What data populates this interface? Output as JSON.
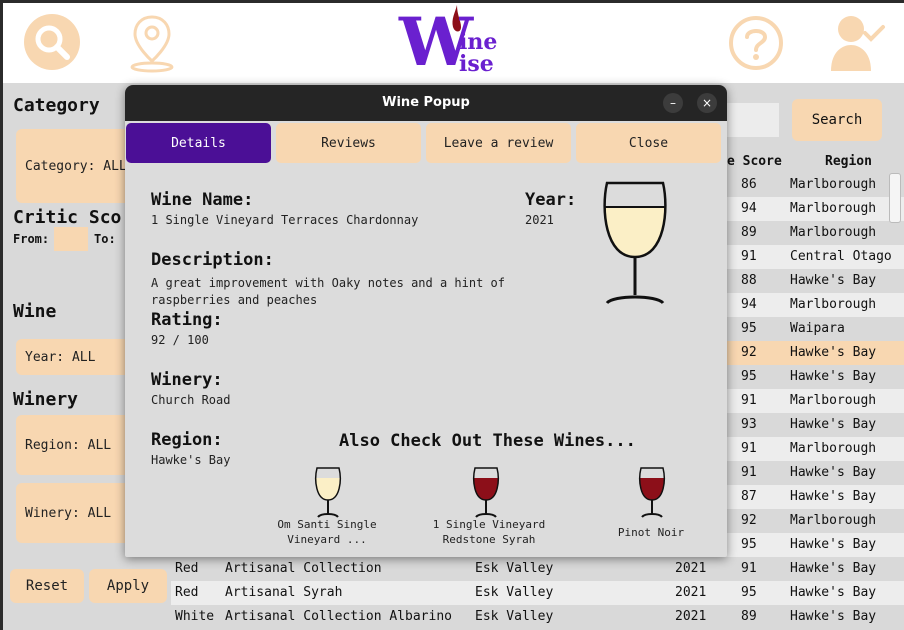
{
  "header": {
    "logo_text_big": "W",
    "logo_text_top": "ine",
    "logo_text_bottom": "ise",
    "icons": [
      "search-icon",
      "location-icon",
      "help-icon",
      "user-check-icon"
    ],
    "accent_color": "#f8d7b1"
  },
  "sidebar": {
    "category_heading": "Category",
    "category_value": "Category: ALL",
    "critic_heading": "Critic Sco",
    "from_label": "From:",
    "to_label": "To:",
    "wine_heading": "Wine",
    "year_value": "Year: ALL",
    "winery_heading": "Winery",
    "region_value": "Region: ALL",
    "winery_value": "Winery: ALL",
    "reset_label": "Reset",
    "apply_label": "Apply"
  },
  "search": {
    "button_label": "Search"
  },
  "table": {
    "col_score": "e Score",
    "col_region": "Region",
    "rows": [
      {
        "score": "86",
        "region": "Marlborough"
      },
      {
        "score": "94",
        "region": "Marlborough"
      },
      {
        "score": "89",
        "region": "Marlborough"
      },
      {
        "score": "91",
        "region": "Central Otago"
      },
      {
        "score": "88",
        "region": "Hawke's Bay"
      },
      {
        "score": "94",
        "region": "Marlborough"
      },
      {
        "score": "95",
        "region": "Waipara"
      },
      {
        "score": "92",
        "region": "Hawke's Bay"
      },
      {
        "score": "95",
        "region": "Hawke's Bay"
      },
      {
        "score": "91",
        "region": "Marlborough"
      },
      {
        "score": "93",
        "region": "Hawke's Bay"
      },
      {
        "score": "91",
        "region": "Marlborough"
      },
      {
        "score": "91",
        "region": "Hawke's Bay"
      },
      {
        "score": "87",
        "region": "Hawke's Bay"
      },
      {
        "score": "92",
        "region": "Marlborough"
      },
      {
        "score": "95",
        "region": "Hawke's Bay"
      }
    ],
    "full_rows": [
      {
        "color": "Red",
        "name": "Artisanal Collection",
        "winery": "Esk Valley",
        "year": "2021",
        "score": "91",
        "region": "Hawke's Bay"
      },
      {
        "color": "Red",
        "name": "Artisanal Syrah",
        "winery": "Esk Valley",
        "year": "2021",
        "score": "95",
        "region": "Hawke's Bay"
      },
      {
        "color": "White",
        "name": "Artisanal Collection Albarino",
        "winery": "Esk Valley",
        "year": "2021",
        "score": "89",
        "region": "Hawke's Bay"
      }
    ]
  },
  "popup": {
    "title": "Wine Popup",
    "minimize": "–",
    "close": "×",
    "tabs": [
      "Details",
      "Reviews",
      "Leave a review",
      "Close"
    ],
    "wine_name_label": "Wine Name:",
    "wine_name": "1 Single Vineyard Terraces Chardonnay",
    "year_label": "Year:",
    "year": "2021",
    "description_label": "Description:",
    "description": "A great improvement with Oaky notes and a hint of raspberries and peaches",
    "rating_label": "Rating:",
    "rating": "92 / 100",
    "winery_label": "Winery:",
    "winery": "Church Road",
    "region_label": "Region:",
    "region": "Hawke's Bay",
    "also_label": "Also Check Out These Wines...",
    "recommendations": [
      {
        "name": "Om Santi Single Vineyard ...",
        "wine": "white"
      },
      {
        "name": "1 Single Vineyard Redstone Syrah",
        "wine": "red"
      },
      {
        "name": "Pinot Noir",
        "wine": "red"
      }
    ],
    "white_wine_color": "#fbefc6",
    "red_wine_color": "#8c0f19"
  }
}
